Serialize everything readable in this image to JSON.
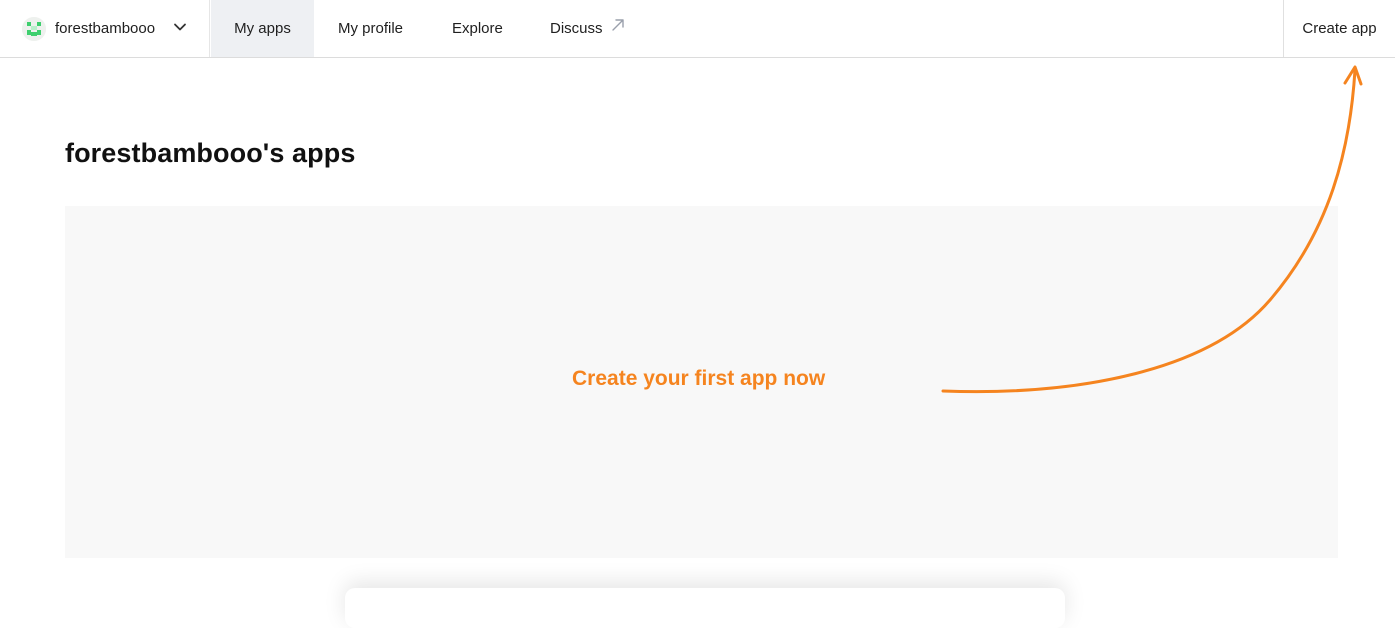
{
  "header": {
    "username": "forestbambooo",
    "tabs": [
      {
        "label": "My apps",
        "active": true
      },
      {
        "label": "My profile",
        "active": false
      },
      {
        "label": "Explore",
        "active": false
      },
      {
        "label": "Discuss",
        "active": false,
        "external": true
      }
    ],
    "create_button_label": "Create app"
  },
  "main": {
    "title": "forestbambooo's apps",
    "empty_state_cta": "Create your first app now"
  },
  "icons": {
    "avatar": "pixel-avatar-icon",
    "dropdown": "chevron-down-icon",
    "external_link": "external-arrow-icon",
    "annotation_arrow": "curved-arrow-icon"
  },
  "colors": {
    "accent": "#f5841f",
    "active_tab_bg": "#eef0f3",
    "panel_bg": "#f8f8f8",
    "avatar_green": "#3ecf6e"
  }
}
